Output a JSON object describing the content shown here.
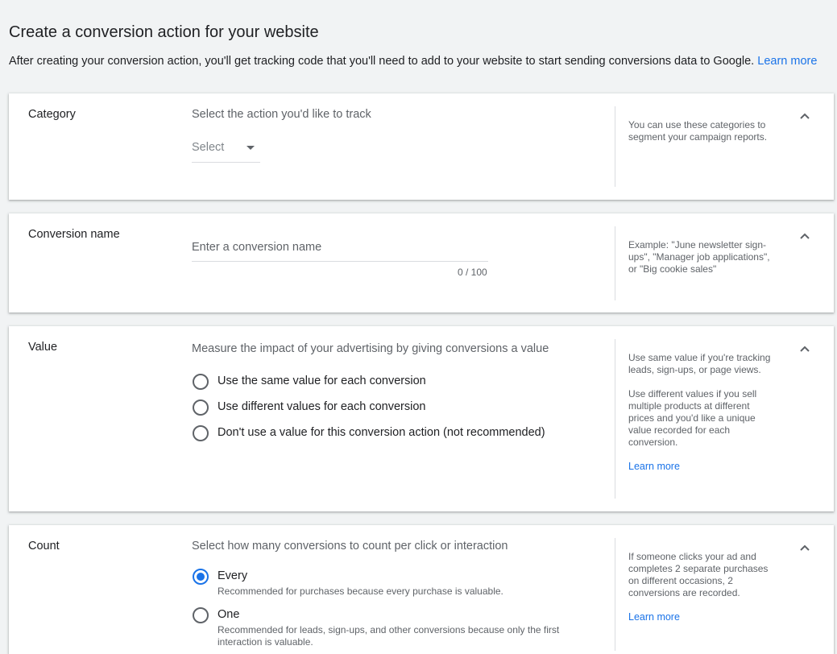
{
  "header": {
    "title": "Create a conversion action for your website",
    "description": "After creating your conversion action, you'll get tracking code that you'll need to add to your website to start sending conversions data to Google.",
    "learn_more": "Learn more"
  },
  "category": {
    "label": "Category",
    "prompt": "Select the action you'd like to track",
    "select_value": "Select",
    "help": "You can use these categories to segment your campaign reports."
  },
  "conversion_name": {
    "label": "Conversion name",
    "placeholder": "Enter a conversion name",
    "value": "",
    "counter": "0 / 100",
    "help": "Example: \"June newsletter sign-ups\", \"Manager job applications\", or \"Big cookie sales\""
  },
  "value": {
    "label": "Value",
    "prompt": "Measure the impact of your advertising by giving conversions a value",
    "options": [
      {
        "label": "Use the same value for each conversion",
        "selected": false
      },
      {
        "label": "Use different values for each conversion",
        "selected": false
      },
      {
        "label": "Don't use a value for this conversion action (not recommended)",
        "selected": false
      }
    ],
    "help_1": "Use same value if you're tracking leads, sign-ups, or page views.",
    "help_2": "Use different values if you sell multiple products at different prices and you'd like a unique value recorded for each conversion.",
    "learn_more": "Learn more"
  },
  "count": {
    "label": "Count",
    "prompt": "Select how many conversions to count per click or interaction",
    "options": [
      {
        "label": "Every",
        "description": "Recommended for purchases because every purchase is valuable.",
        "selected": true
      },
      {
        "label": "One",
        "description": "Recommended for leads, sign-ups, and other conversions because only the first interaction is valuable.",
        "selected": false
      }
    ],
    "help": "If someone clicks your ad and completes 2 separate purchases on different occasions, 2 conversions are recorded.",
    "learn_more": "Learn more"
  },
  "colors": {
    "accent": "#1a73e8",
    "background": "#f1f3f4",
    "text": "#202124",
    "secondary_text": "#5f6368"
  }
}
